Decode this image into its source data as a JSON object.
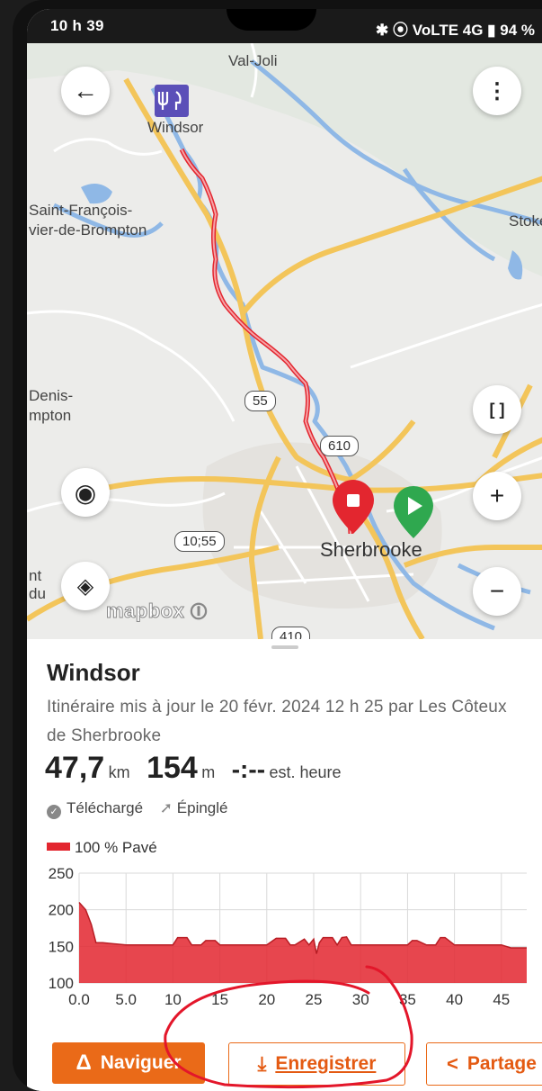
{
  "status_bar": {
    "time": "10 h 39",
    "indicators": "⎋ [ ] ⎋",
    "right": "✱ ⦿ VoLTE 4G ▮ 94 %"
  },
  "map": {
    "labels": {
      "val_joli": "Val-Joli",
      "windsor": "Windsor",
      "saint_francois_1": "Saint-François-",
      "saint_francois_2": "vier-de-Brompton",
      "stoke": "Stoke",
      "denis_1": "Denis-",
      "denis_2": "mpton",
      "sherbrooke": "Sherbrooke",
      "nt": "nt",
      "du": "du"
    },
    "shields": {
      "r55": "55",
      "r610": "610",
      "r1055": "10;55",
      "r410": "410"
    },
    "attribution": "mapbox",
    "icons": [
      "back-arrow-icon",
      "more-vert-icon",
      "fullscreen-icon",
      "locate-icon",
      "zoom-in-icon",
      "zoom-out-icon",
      "layers-icon",
      "info-icon"
    ]
  },
  "sheet": {
    "title": "Windsor",
    "subtitle": "Itinéraire mis à jour le 20 févr. 2024 12 h 25 par Les Côteux de Sherbrooke",
    "distance_value": "47,7",
    "distance_unit": "km",
    "elevation_value": "154",
    "elevation_unit": "m",
    "time_value": "-:--",
    "time_unit": "est. heure",
    "downloaded": "Téléchargé",
    "pinned": "Épinglé",
    "surface_legend": "100 % Pavé"
  },
  "chart_data": {
    "type": "area",
    "x": [
      0,
      0.7,
      1.3,
      1.8,
      2.5,
      5,
      10,
      10.5,
      11.5,
      12,
      13,
      13.5,
      14.5,
      15,
      20,
      21,
      22,
      22.5,
      23,
      24,
      24.5,
      25,
      25.3,
      25.6,
      26,
      27,
      27.5,
      28,
      28.5,
      29,
      30,
      35,
      35.5,
      36,
      37,
      38,
      38.5,
      39,
      40,
      45,
      46,
      47,
      47.7
    ],
    "y": [
      210,
      200,
      180,
      155,
      155,
      152,
      152,
      162,
      162,
      152,
      152,
      158,
      158,
      152,
      152,
      161,
      161,
      152,
      152,
      160,
      152,
      160,
      140,
      155,
      162,
      162,
      152,
      162,
      163,
      152,
      152,
      152,
      158,
      158,
      152,
      152,
      162,
      162,
      152,
      152,
      148,
      148,
      148
    ],
    "xlim": [
      0,
      47.7
    ],
    "ylim": [
      100,
      250
    ],
    "xticks": [
      "0.0",
      "5.0",
      "10",
      "15",
      "20",
      "25",
      "30",
      "35",
      "40",
      "45"
    ],
    "xtick_values": [
      0,
      5,
      10,
      15,
      20,
      25,
      30,
      35,
      40,
      45
    ],
    "yticks": [
      "250",
      "200",
      "150",
      "100"
    ],
    "ytick_values": [
      250,
      200,
      150,
      100
    ],
    "grid": true,
    "color": "#e3262f"
  },
  "buttons": {
    "navigate": "Naviguer",
    "save": "Enregistrer",
    "share": "Partage"
  },
  "colors": {
    "accent": "#ea6a18",
    "route": "#e3262f",
    "map_bg": "#eeeeec"
  }
}
